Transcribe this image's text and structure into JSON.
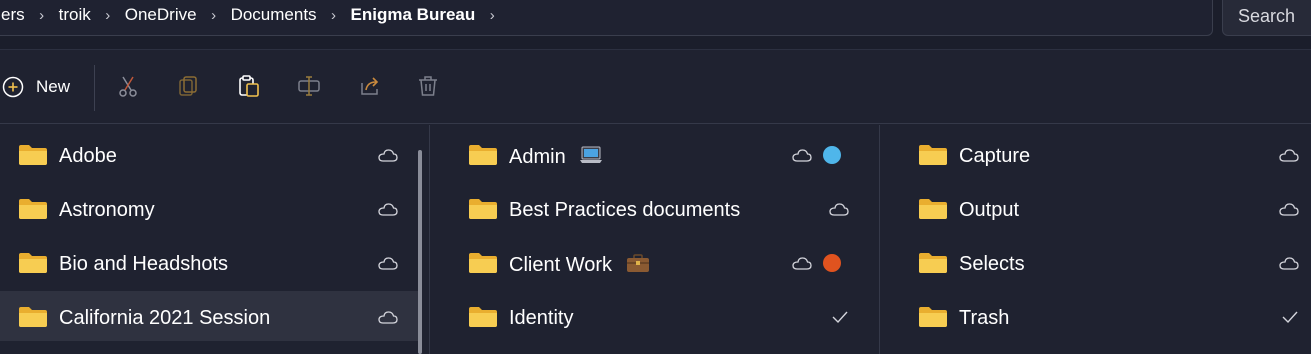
{
  "breadcrumb": {
    "items": [
      "ers",
      "troik",
      "OneDrive",
      "Documents",
      "Enigma Bureau"
    ]
  },
  "search": {
    "label": "Search"
  },
  "toolbar": {
    "new_label": "New",
    "icons": [
      "cut-icon",
      "copy-icon",
      "paste-icon",
      "rename-icon",
      "share-icon",
      "delete-icon"
    ]
  },
  "columns": [
    {
      "items": [
        {
          "label": "Adobe",
          "status": "cloud"
        },
        {
          "label": "Astronomy",
          "status": "cloud"
        },
        {
          "label": "Bio and Headshots",
          "status": "cloud"
        },
        {
          "label": "California 2021 Session",
          "status": "cloud",
          "selected": true
        }
      ]
    },
    {
      "items": [
        {
          "label": "Admin",
          "emoji": "laptop",
          "status": "cloud",
          "tag_color": "#4fb6ea"
        },
        {
          "label": "Best Practices documents",
          "status": "cloud"
        },
        {
          "label": "Client Work",
          "emoji": "briefcase",
          "status": "cloud",
          "tag_color": "#e0531f"
        },
        {
          "label": "Identity",
          "status": "check"
        }
      ]
    },
    {
      "items": [
        {
          "label": "Capture",
          "status": "cloud"
        },
        {
          "label": "Output",
          "status": "cloud"
        },
        {
          "label": "Selects",
          "status": "cloud"
        },
        {
          "label": "Trash",
          "status": "check"
        }
      ]
    }
  ],
  "colors": {
    "background": "#1f2230",
    "selected_row": "#2f3240",
    "folder": "#f7c94b",
    "accent_icon": "#e8a33c"
  }
}
